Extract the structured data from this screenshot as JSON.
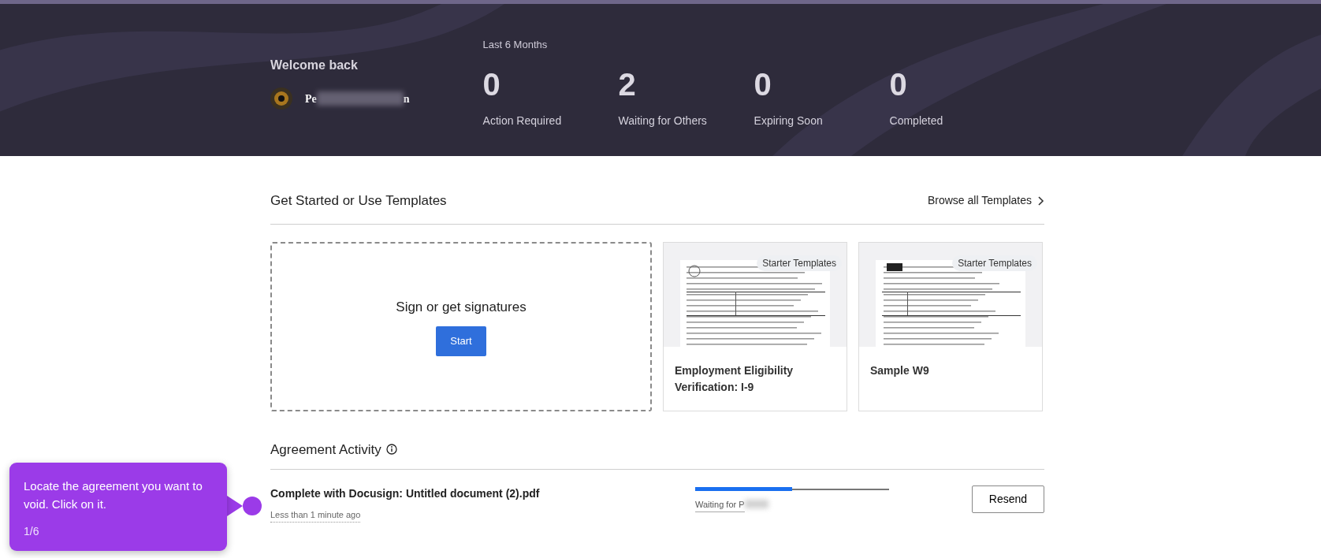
{
  "header": {
    "welcome": "Welcome back",
    "user_name_start": "Pe",
    "user_name_end": "n",
    "period": "Last 6 Months",
    "stats": [
      {
        "value": "0",
        "label": "Action Required"
      },
      {
        "value": "2",
        "label": "Waiting for Others"
      },
      {
        "value": "0",
        "label": "Expiring Soon"
      },
      {
        "value": "0",
        "label": "Completed"
      }
    ]
  },
  "templates": {
    "title": "Get Started or Use Templates",
    "browse_link": "Browse all Templates",
    "start_card": {
      "title": "Sign or get signatures",
      "button": "Start"
    },
    "items": [
      {
        "badge": "Starter Templates",
        "name": "Employment Eligibility Verification: I-9"
      },
      {
        "badge": "Starter Templates",
        "name": "Sample W9"
      }
    ]
  },
  "activity": {
    "title": "Agreement Activity",
    "rows": [
      {
        "title": "Complete with Docusign: Untitled document (2).pdf",
        "time": "Less than 1 minute ago",
        "level": 0.5,
        "status": "Waiting for P",
        "button": "Resend"
      }
    ]
  },
  "tooltip": {
    "text": "Locate the agreement you want to void. Click on it.",
    "step": "1/6"
  }
}
